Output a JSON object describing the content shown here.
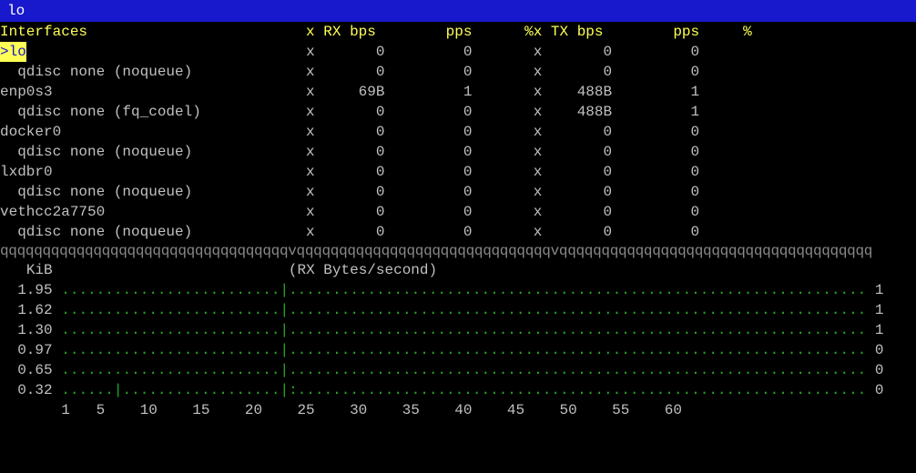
{
  "titlebar": {
    "text": "lo"
  },
  "header": {
    "interfaces": "Interfaces",
    "x1": "x",
    "rxbps": "RX bps",
    "pps1": "pps",
    "pctx": "%x",
    "txbps": "TX bps",
    "pps2": "pps",
    "pct": "%"
  },
  "rows": [
    {
      "sel": true,
      "name": "lo",
      "x1": "x",
      "rx": "0",
      "pps1": "0",
      "pctx": "x",
      "tx": "0",
      "pps2": "0"
    },
    {
      "sel": false,
      "name": "  qdisc none (noqueue)",
      "x1": "x",
      "rx": "0",
      "pps1": "0",
      "pctx": "x",
      "tx": "0",
      "pps2": "0"
    },
    {
      "sel": false,
      "name": "enp0s3",
      "x1": "x",
      "rx": "69B",
      "pps1": "1",
      "pctx": "x",
      "tx": "488B",
      "pps2": "1"
    },
    {
      "sel": false,
      "name": "  qdisc none (fq_codel)",
      "x1": "x",
      "rx": "0",
      "pps1": "0",
      "pctx": "x",
      "tx": "488B",
      "pps2": "1"
    },
    {
      "sel": false,
      "name": "docker0",
      "x1": "x",
      "rx": "0",
      "pps1": "0",
      "pctx": "x",
      "tx": "0",
      "pps2": "0"
    },
    {
      "sel": false,
      "name": "  qdisc none (noqueue)",
      "x1": "x",
      "rx": "0",
      "pps1": "0",
      "pctx": "x",
      "tx": "0",
      "pps2": "0"
    },
    {
      "sel": false,
      "name": "lxdbr0",
      "x1": "x",
      "rx": "0",
      "pps1": "0",
      "pctx": "x",
      "tx": "0",
      "pps2": "0"
    },
    {
      "sel": false,
      "name": "  qdisc none (noqueue)",
      "x1": "x",
      "rx": "0",
      "pps1": "0",
      "pctx": "x",
      "tx": "0",
      "pps2": "0"
    },
    {
      "sel": false,
      "name": "vethcc2a7750",
      "x1": "x",
      "rx": "0",
      "pps1": "0",
      "pctx": "x",
      "tx": "0",
      "pps2": "0"
    },
    {
      "sel": false,
      "name": "  qdisc none (noqueue)",
      "x1": "x",
      "rx": "0",
      "pps1": "0",
      "pctx": "x",
      "tx": "0",
      "pps2": "0"
    }
  ],
  "separator": "qqqqqqqqqqqqqqqqqqqqqqqqqqqqqqqqqqvqqqqqqqqqqqqqqqqqqqqqqqqqqqqqqvqqqqqqqqqqqqqqqqqqqqqqqqqqqqqqqqqqqqq",
  "chart_data": {
    "type": "line",
    "title": "(RX Bytes/second)",
    "ylabel_unit": "KiB",
    "xlabel": "",
    "y_ticks": [
      "1.95",
      "1.62",
      "1.30",
      "0.97",
      "0.65",
      "0.32"
    ],
    "x_ticks": [
      "1",
      "5",
      "10",
      "15",
      "20",
      "25",
      "30",
      "35",
      "40",
      "45",
      "50",
      "55",
      "60"
    ],
    "ylim": [
      0,
      1.95
    ],
    "xlim": [
      1,
      60
    ],
    "right_values": [
      "1",
      "1",
      "1",
      "0",
      "0",
      "0"
    ],
    "series": [
      {
        "name": "RX Bytes/second",
        "values": []
      }
    ]
  }
}
